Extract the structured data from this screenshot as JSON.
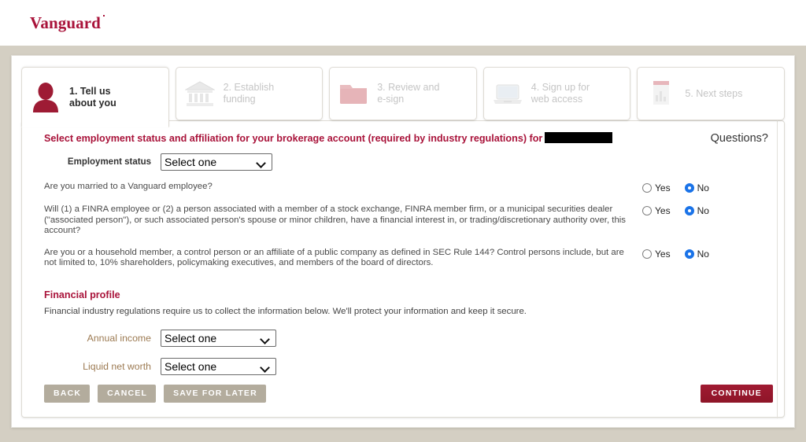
{
  "brand": {
    "name": "Vanguard"
  },
  "steps": [
    {
      "label": "1. Tell us\nabout you",
      "icon": "person-icon",
      "active": true
    },
    {
      "label": "2. Establish\nfunding",
      "icon": "bank-icon",
      "active": false
    },
    {
      "label": "3. Review and\ne-sign",
      "icon": "folder-icon",
      "active": false
    },
    {
      "label": "4. Sign up for\nweb access",
      "icon": "laptop-icon",
      "active": false
    },
    {
      "label": "5. Next steps",
      "icon": "report-chart-icon",
      "active": false
    }
  ],
  "form": {
    "heading": "Select employment status and affiliation for your brokerage account (required by industry regulations) for",
    "heading_redacted": true,
    "questions_link": "Questions?",
    "employment": {
      "label": "Employment status",
      "value": "Select one",
      "options": [
        "Select one"
      ]
    },
    "questions": [
      {
        "text": "Are you married to a Vanguard employee?",
        "yes_label": "Yes",
        "no_label": "No",
        "selected": "No"
      },
      {
        "text": "Will (1) a FINRA employee or (2) a person associated with a member of a stock exchange, FINRA member firm, or a municipal securities dealer (\"associated person\"), or such associated person's spouse or minor children, have a financial interest in, or trading/discretionary authority over, this account?",
        "yes_label": "Yes",
        "no_label": "No",
        "selected": "No"
      },
      {
        "text": "Are you or a household member, a control person or an affiliate of a public company as defined in SEC Rule 144? Control persons include, but are not limited to, 10% shareholders, policymaking executives, and members of the board of directors.",
        "yes_label": "Yes",
        "no_label": "No",
        "selected": "No"
      }
    ],
    "financial_profile": {
      "title": "Financial profile",
      "subtitle": "Financial industry regulations require us to collect the information below. We'll protect your information and keep it secure.",
      "annual_income": {
        "label": "Annual income",
        "value": "Select one",
        "options": [
          "Select one"
        ]
      },
      "liquid_net_worth": {
        "label": "Liquid net worth",
        "value": "Select one",
        "options": [
          "Select one"
        ]
      }
    }
  },
  "footer": {
    "back": "BACK",
    "cancel": "CANCEL",
    "save_for_later": "SAVE FOR LATER",
    "continue": "CONTINUE"
  },
  "colors": {
    "brand_red": "#a9133a",
    "frame_beige": "#d4cfc3",
    "button_gray": "#b3ac9d",
    "primary_button": "#9e1b32",
    "radio_blue": "#1a73e8",
    "tan_label": "#9c7a52"
  }
}
